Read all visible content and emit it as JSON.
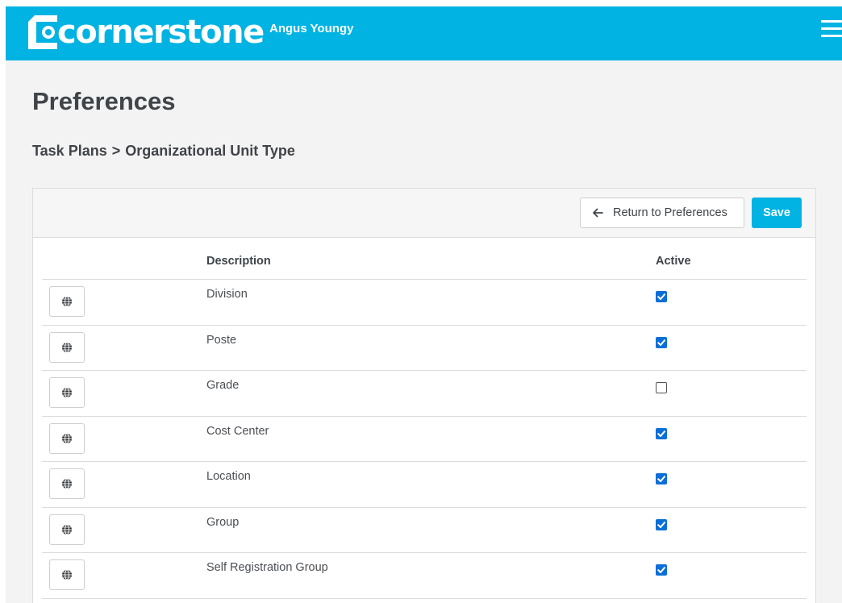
{
  "app": {
    "brand": "cornerstone",
    "user_name": "Angus Youngy"
  },
  "page": {
    "title": "Preferences"
  },
  "breadcrumb": {
    "parent": "Task Plans",
    "separator": ">",
    "current": "Organizational Unit Type"
  },
  "toolbar": {
    "return_label": "Return to Preferences",
    "save_label": "Save"
  },
  "table": {
    "columns": {
      "description": "Description",
      "active": "Active"
    },
    "rows": [
      {
        "description": "Division",
        "active": true
      },
      {
        "description": "Poste",
        "active": true
      },
      {
        "description": "Grade",
        "active": false
      },
      {
        "description": "Cost Center",
        "active": true
      },
      {
        "description": "Location",
        "active": true
      },
      {
        "description": "Group",
        "active": true
      },
      {
        "description": "Self Registration Group",
        "active": true
      }
    ]
  },
  "icons": {
    "menu": "hamburger-icon",
    "back": "arrow-left-icon",
    "row_action": "globe-icon"
  },
  "colors": {
    "brand": "#00b3e3",
    "checkbox": "#0a6fd8",
    "text": "#3f4449"
  }
}
